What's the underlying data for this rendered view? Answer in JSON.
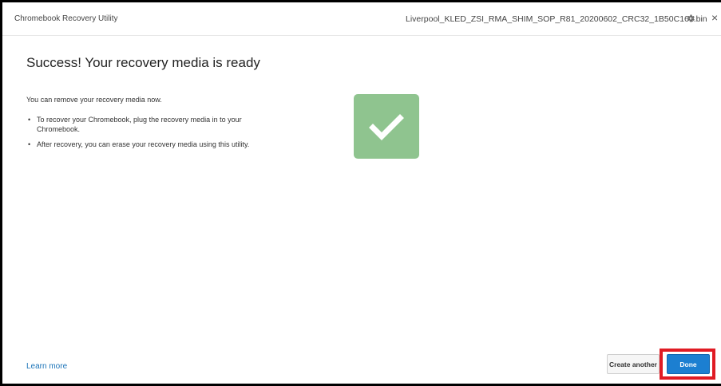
{
  "window": {
    "app_title": "Chromebook Recovery Utility",
    "file_name": "Liverpool_KLED_ZSI_RMA_SHIM_SOP_R81_20200602_CRC32_1B50C161.bin",
    "close_glyph": "×"
  },
  "main": {
    "heading": "Success! Your recovery media is ready",
    "intro": "You can remove your recovery media now.",
    "bullets": [
      {
        "line1": "To recover your Chromebook, plug the recovery media in to your",
        "line2": "Chromebook."
      },
      {
        "line1": "After recovery, you can erase your recovery media using this utility.",
        "line2": ""
      }
    ],
    "bullet_glyph": "•"
  },
  "footer": {
    "learn_more": "Learn more",
    "create_another": "Create another",
    "done": "Done"
  },
  "colors": {
    "success_tile": "#8fc48f",
    "done_button": "#1c7fd1",
    "link": "#1a73b8",
    "highlight": "#e01b24"
  },
  "icons": {
    "settings": "gear-icon",
    "close": "close-icon",
    "success": "checkmark-icon"
  }
}
